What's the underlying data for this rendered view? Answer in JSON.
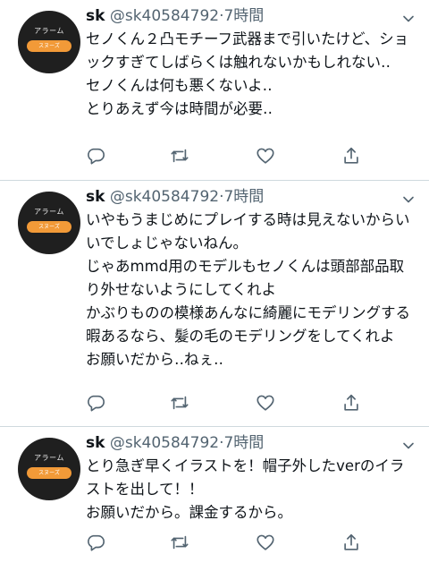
{
  "avatar": {
    "caption": "アラーム",
    "button": "スヌーズ"
  },
  "tweets": [
    {
      "name": "sk",
      "handle": "@sk40584792",
      "dot": "·",
      "time": "7時間",
      "text": "セノくん２凸モチーフ武器まで引いたけど、ショックすぎてしばらくは触れないかもしれない‥\nセノくんは何も悪くないよ‥\nとりあえず今は時間が必要‥"
    },
    {
      "name": "sk",
      "handle": "@sk40584792",
      "dot": "·",
      "time": "7時間",
      "text": "いやもうまじめにプレイする時は見えないからいいでしょじゃないねん。\nじゃあmmd用のモデルもセノくんは頭部部品取り外せないようにしてくれよ\nかぶりものの模様あんなに綺麗にモデリングする暇あるなら、髪の毛のモデリングをしてくれよ\nお願いだから‥ねぇ‥"
    },
    {
      "name": "sk",
      "handle": "@sk40584792",
      "dot": "·",
      "time": "7時間",
      "text": "とり急ぎ早くイラストを！帽子外したverのイラストを出して！！\nお願いだから。課金するから。"
    }
  ],
  "icons": {
    "reply": "reply-icon",
    "retweet": "retweet-icon",
    "like": "like-icon",
    "share": "share-icon",
    "menu": "chevron-down-icon"
  },
  "colors": {
    "text": "#0f1419",
    "secondary": "#536471",
    "divider": "#cfd9de",
    "avatar_bg": "#1f1f1f",
    "avatar_button": "#f29a38"
  }
}
